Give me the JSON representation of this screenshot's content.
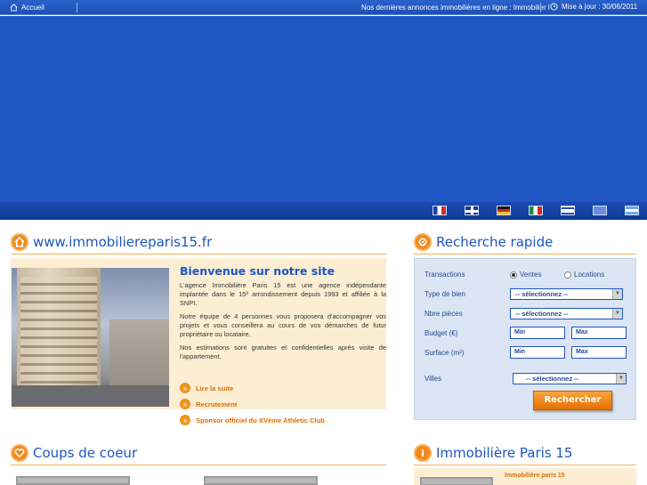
{
  "topbar": {
    "home_label": "Accueil",
    "news_text": "Nos dernières annonces immobilières en ligne : Immobilier l",
    "update_text": "Mise à jour : 30/06/2011"
  },
  "languages": [
    "fr",
    "uk",
    "de",
    "it",
    "il",
    "cn",
    "ar"
  ],
  "welcome_section": {
    "heading": "www.immobiliereparis15.fr",
    "title": "Bienvenue sur notre site",
    "paragraphs": [
      "L'agence Immobilière Paris 15 est une agence indépendante implantée dans le 15ª arrondissement depuis 1993 et affiliée à la SNPI.",
      "Notre équipe de 4 personnes vous proposera d'accompagner vos projets et vous conseillera au cours de vos démarches de futur propriétaire ou locataire.",
      "Nos estimations sont gratuites et confidentielles après visite de l'appartement."
    ],
    "links": [
      "Lire la suite",
      "Recrutement",
      "Sponsor officiel du XVème Athletic Club"
    ]
  },
  "search": {
    "heading": "Recherche rapide",
    "transactions_label": "Transactions",
    "option_sale": "Ventes",
    "option_rent": "Locations",
    "type_label": "Type de bien",
    "type_value": "-- sélectionnez --",
    "rooms_label": "Nbre pièces",
    "rooms_value": "-- sélectionnez --",
    "budget_label": "Budget (€)",
    "surface_label": "Surface (m²)",
    "min_label": "Min",
    "max_label": "Max",
    "cities_label": "Villes",
    "cities_value": "-- sélectionnez --",
    "submit_label": "Rechercher"
  },
  "favorites": {
    "heading": "Coups de coeur"
  },
  "agency": {
    "heading": "Immobilière Paris 15",
    "link": "Immobilière paris 15"
  }
}
